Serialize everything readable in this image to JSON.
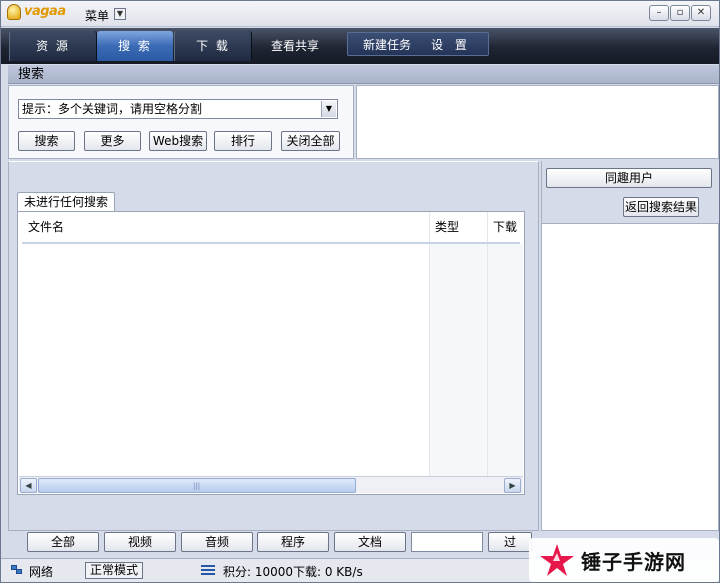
{
  "app": {
    "logo_text": "vagaa",
    "menu_label": "菜单"
  },
  "nav": {
    "tabs": [
      "资 源",
      "搜 索",
      "下 载",
      "查看共享",
      "新建任务",
      "设 置"
    ],
    "active_index": 1
  },
  "section": {
    "title": "搜索"
  },
  "search": {
    "hint": "提示：多个关键词，请用空格分割",
    "buttons": [
      "搜索",
      "更多",
      "Web搜索",
      "排行",
      "关闭全部"
    ]
  },
  "results": {
    "tab_label": "未进行任何搜索",
    "columns": [
      "文件名",
      "类型",
      "下载"
    ]
  },
  "right_panel": {
    "users_button": "同趣用户",
    "back_button": "返回搜索结果"
  },
  "filters": {
    "buttons": [
      "全部",
      "视频",
      "音频",
      "程序",
      "文档"
    ],
    "go_label": "过"
  },
  "status": {
    "network": "网络",
    "mode": "正常模式",
    "points": "积分: 10000",
    "download": "下载: 0 KB/s"
  },
  "watermark": {
    "text": "锤子手游网"
  },
  "colors": {
    "nav_active": "#3c6bb6",
    "nav_bg": "#1f2533",
    "panel_bg": "#d6dbe9",
    "logo": "#e09a00"
  }
}
